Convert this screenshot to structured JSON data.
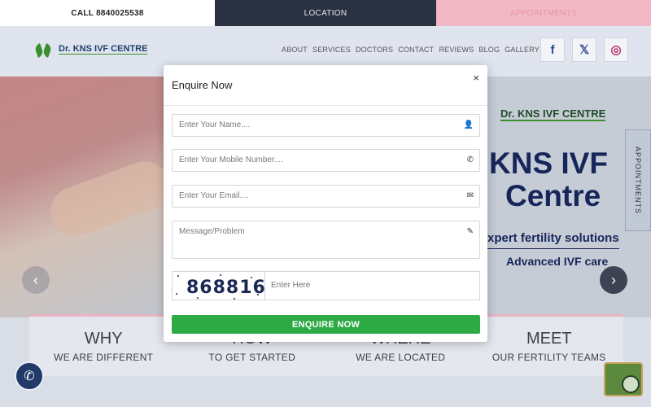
{
  "topbar": {
    "call_label": "CALL 8840025538",
    "location_label": "LOCATION",
    "appointments_label": "APPOINTMENTS"
  },
  "header": {
    "logo_text": "Dr. KNS IVF CENTRE",
    "nav": [
      "ABOUT",
      "SERVICES",
      "DOCTORS",
      "CONTACT",
      "REVIEWS",
      "BLOG",
      "GALLERY"
    ],
    "social": [
      {
        "icon": "facebook-icon",
        "glyph": "f"
      },
      {
        "icon": "x-icon",
        "glyph": "𝕏"
      },
      {
        "icon": "instagram-icon",
        "glyph": "◎"
      }
    ]
  },
  "hero": {
    "logo_text": "Dr. KNS IVF CENTRE",
    "headline_1": "KNS IVF",
    "headline_2": "Centre",
    "tagline_1": "xpert fertility solutions",
    "tagline_2": "Advanced IVF care",
    "side_tab": "APPOINTMENTS"
  },
  "cards": [
    {
      "title": "WHY",
      "subtitle": "WE ARE DIFFERENT"
    },
    {
      "title": "HOW",
      "subtitle": "TO GET STARTED"
    },
    {
      "title": "WHERE",
      "subtitle": "WE ARE LOCATED"
    },
    {
      "title": "MEET",
      "subtitle": "OUR FERTILITY TEAMS"
    }
  ],
  "modal": {
    "title": "Enquire Now",
    "close": "×",
    "name_placeholder": "Enter Your Name....",
    "mobile_placeholder": "Enter Your Mobile Number....",
    "email_placeholder": "Enter Your Email....",
    "message_placeholder": "Message/Problem",
    "captcha_code": "868816",
    "captcha_placeholder": "Enter Here",
    "submit_label": "ENQUIRE NOW"
  },
  "colors": {
    "brand_navy": "#17265a",
    "brand_green": "#3b8f2a",
    "submit_green": "#2eaa45",
    "topbar_dark": "#2a3140",
    "topbar_pink": "#f2b8c6"
  }
}
